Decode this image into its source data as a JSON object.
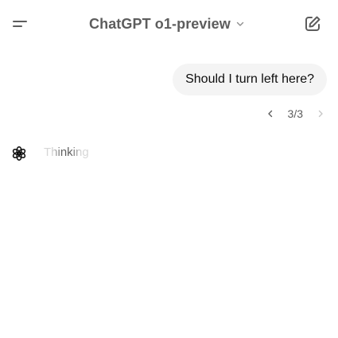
{
  "header": {
    "menu_icon": "menu-icon",
    "model_name": "ChatGPT o1-preview",
    "dropdown_icon": "chevron-down-icon",
    "new_chat_icon": "compose-icon"
  },
  "conversation": {
    "user_message": "Should I turn left here?",
    "pager": {
      "counter": "3/3",
      "prev_icon": "chevron-left-icon",
      "next_icon": "chevron-right-icon"
    },
    "assistant": {
      "avatar_icon": "openai-logo-icon",
      "status_text": "Thinking"
    }
  },
  "colors": {
    "text_primary": "#0d0d0d",
    "text_secondary": "#5d5d5d",
    "bubble_bg": "#f4f4f4",
    "background": "#ffffff"
  }
}
